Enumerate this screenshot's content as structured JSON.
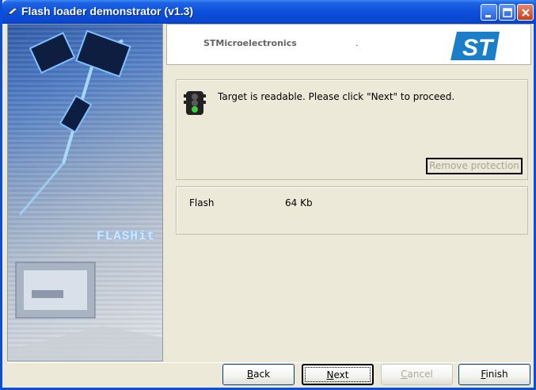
{
  "window": {
    "title": "Flash loader demonstrator (v1.3)"
  },
  "sidebar": {
    "brand_text": "FLASHit"
  },
  "header": {
    "company": "STMicroelectronics",
    "dot": ".",
    "logo_text": "ST"
  },
  "status": {
    "message": "Target is readable. Please click \"Next\" to proceed.",
    "remove_protection_label": "Remove protection"
  },
  "memory": {
    "type_label": "Flash",
    "size": "64 Kb"
  },
  "buttons": {
    "back": {
      "first": "B",
      "rest": "ack"
    },
    "next": {
      "first": "N",
      "rest": "ext"
    },
    "cancel": {
      "first": "C",
      "rest": "ancel"
    },
    "finish": {
      "first": "F",
      "rest": "inish"
    }
  },
  "colors": {
    "titlebar": "#0a50dc",
    "dialog_bg": "#ece9d8",
    "logo_blue": "#1a7ec8",
    "disabled_text": "#aca899"
  },
  "icons": {
    "app": "flash-loader-icon",
    "status": "traffic-light-icon"
  }
}
